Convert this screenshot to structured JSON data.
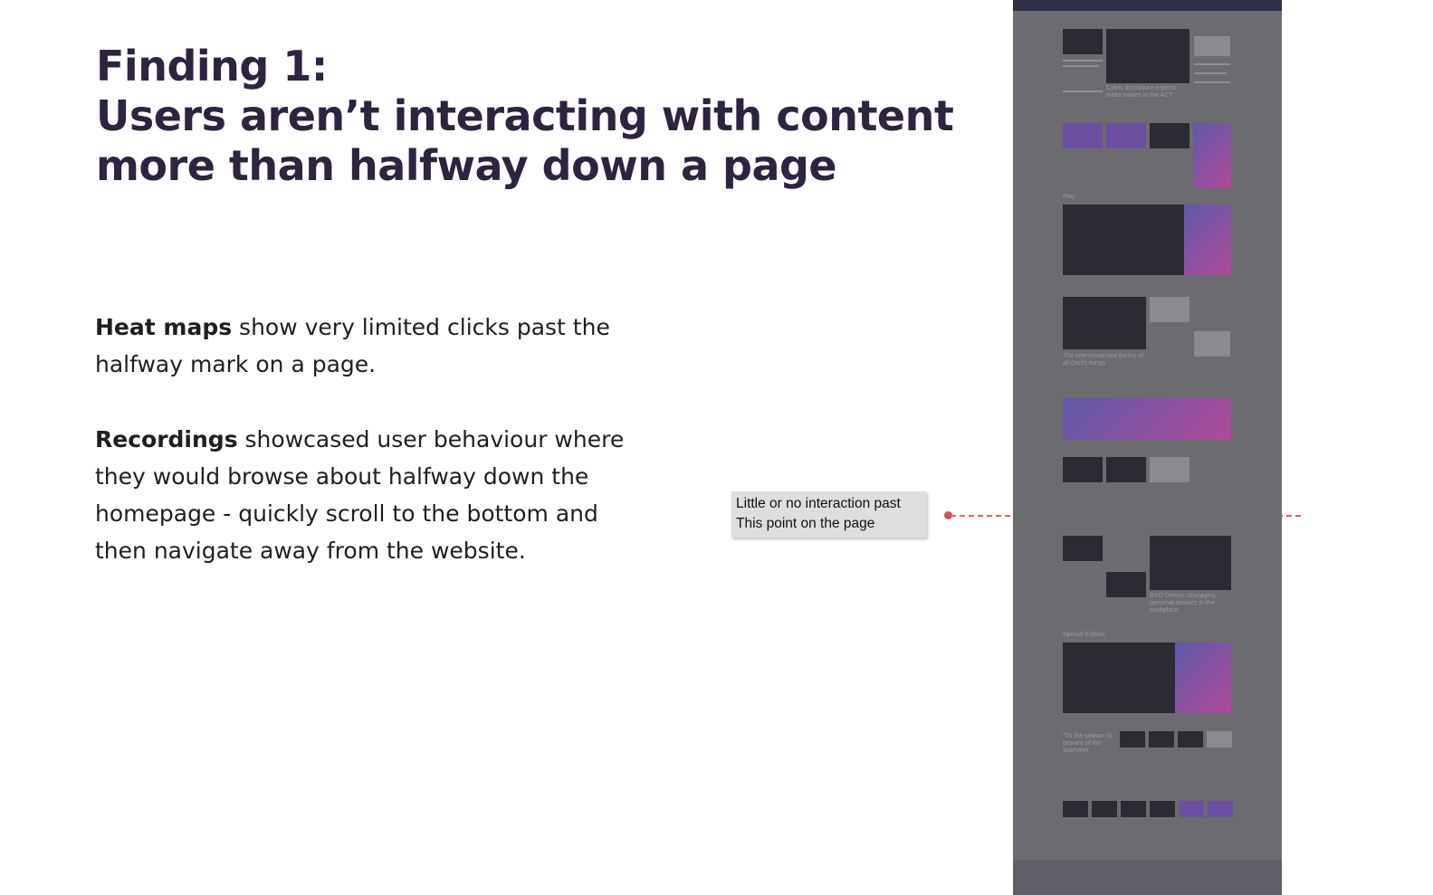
{
  "slide": {
    "title_line1": "Finding 1:",
    "title_line2": "Users aren’t interacting with content",
    "title_line3": "more than halfway down a page",
    "p1_bold": "Heat maps",
    "p1_rest": " show very limited clicks past the halfway mark on a page.",
    "p2_bold": "Recordings",
    "p2_rest": " showcased user behaviour where they would browse about halfway down the homepage - quickly scroll to the bottom and then navigate away from the website.",
    "callout_line1": "Little or no interaction past",
    "callout_line2": "This point on the page"
  },
  "thumbnail": {
    "section_play": "Play",
    "section_special": "Special Edition",
    "headline_1": "Cyber disclosure experts make waves in the ACT",
    "headline_2": "The interconnected theory of all (tech) things",
    "headline_3": "BYO Device: Managing personal devices in the workplace",
    "headline_4": "'Tis the season to beware of the scammer"
  },
  "colors": {
    "title": "#2e2440",
    "marker": "#d9534f",
    "callout_bg": "#dedede",
    "thumb_overlay": "#6b6b70"
  }
}
